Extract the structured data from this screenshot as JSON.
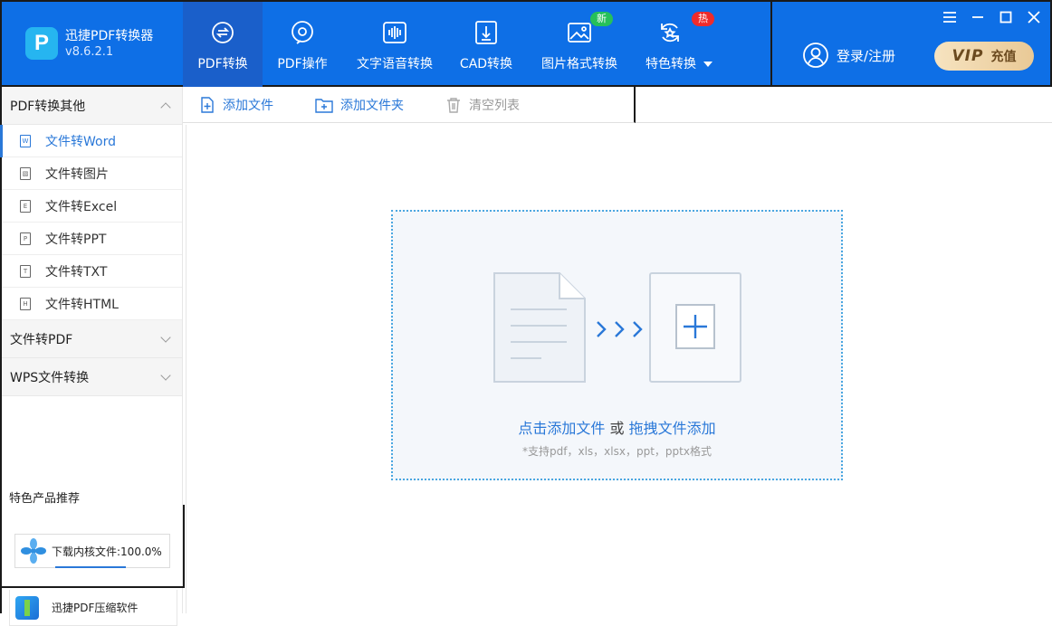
{
  "app": {
    "name": "迅捷PDF转换器",
    "version": "v8.6.2.1"
  },
  "nav": {
    "items": [
      {
        "label": "PDF转换",
        "icon": "pdf-convert-icon",
        "active": true
      },
      {
        "label": "PDF操作",
        "icon": "pdf-operate-icon"
      },
      {
        "label": "文字语音转换",
        "icon": "audio-wave-icon"
      },
      {
        "label": "CAD转换",
        "icon": "cad-icon"
      },
      {
        "label": "图片格式转换",
        "icon": "image-icon",
        "badge": "新"
      },
      {
        "label": "特色转换",
        "icon": "special-convert-icon",
        "badge": "热"
      }
    ]
  },
  "account": {
    "login_label": "登录/注册",
    "vip_main": "VIP",
    "vip_sub": "充值"
  },
  "sidebar": {
    "group1": {
      "title": "PDF转换其他",
      "items": [
        {
          "label": "文件转Word",
          "icon": "W"
        },
        {
          "label": "文件转图片",
          "icon": "▧"
        },
        {
          "label": "文件转Excel",
          "icon": "E"
        },
        {
          "label": "文件转PPT",
          "icon": "P"
        },
        {
          "label": "文件转TXT",
          "icon": "T"
        },
        {
          "label": "文件转HTML",
          "icon": "H"
        }
      ]
    },
    "group2": {
      "title": "文件转PDF"
    },
    "group3": {
      "title": "WPS文件转换"
    },
    "featured_title": "特色产品推荐",
    "download_status": "下载内核文件:100.0%",
    "promo_label": "迅捷PDF压缩软件"
  },
  "toolbar": {
    "add_file": "添加文件",
    "add_folder": "添加文件夹",
    "clear_list": "清空列表"
  },
  "dropzone": {
    "click_add": "点击添加文件",
    "or": "或",
    "drag_add": "拖拽文件添加",
    "supported": "*支持pdf，xls，xlsx，ppt，pptx格式"
  },
  "colors": {
    "top_bar": "#0e6fe6",
    "accent": "#2a78d8",
    "badge_new": "#26c05a",
    "badge_hot": "#ef2b2b"
  }
}
